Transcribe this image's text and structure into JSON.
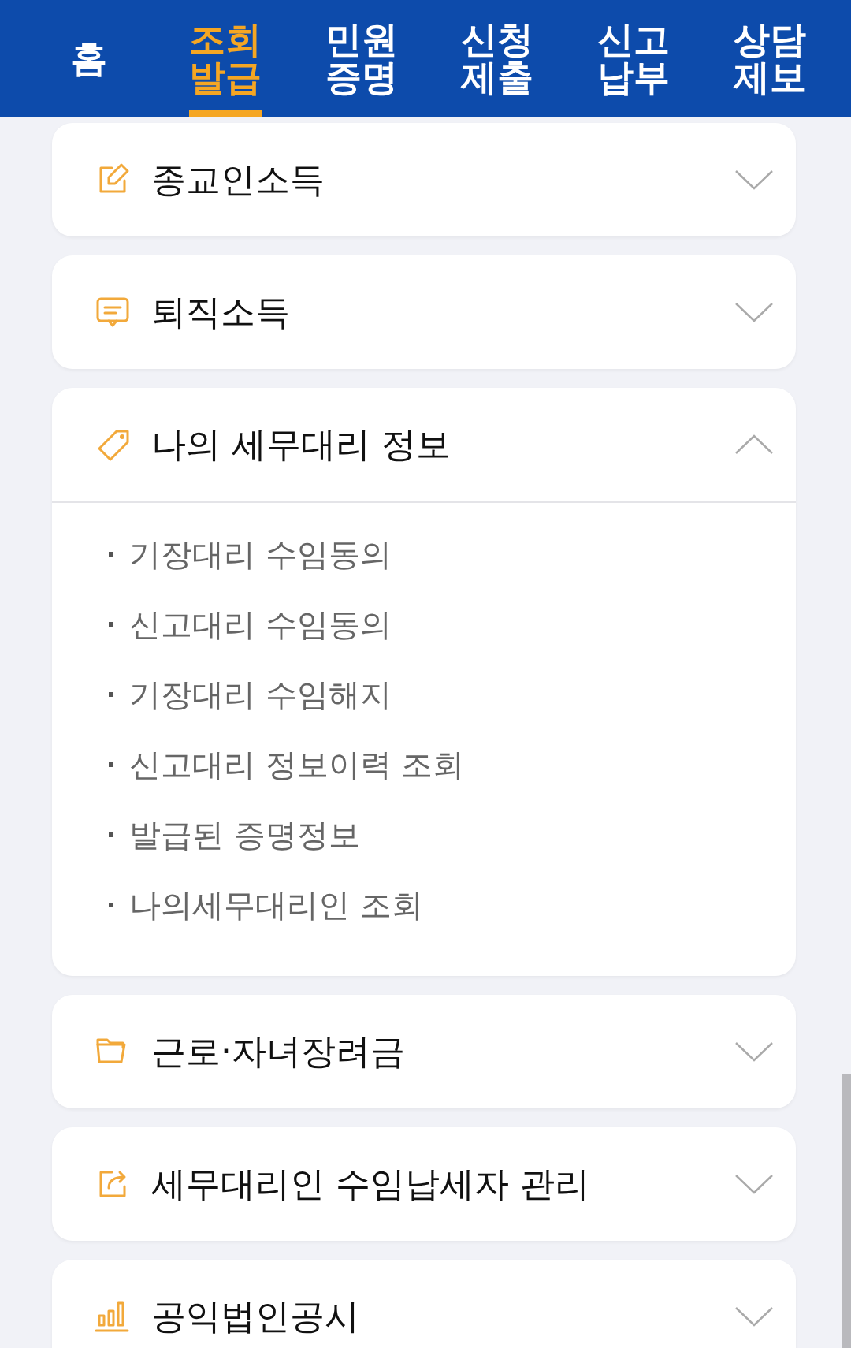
{
  "tabs": [
    {
      "label": "홈",
      "selected": false
    },
    {
      "label": "조회 발급",
      "selected": true
    },
    {
      "label": "민원 증명",
      "selected": false
    },
    {
      "label": "신청 제출",
      "selected": false
    },
    {
      "label": "신고 납부",
      "selected": false
    },
    {
      "label": "상담 제보",
      "selected": false
    }
  ],
  "sections": [
    {
      "kind": "pencil",
      "title": "종교인소득",
      "expanded": false
    },
    {
      "kind": "chat",
      "title": "퇴직소득",
      "expanded": false
    },
    {
      "kind": "tag",
      "title": "나의 세무대리 정보",
      "expanded": true,
      "items": [
        "기장대리 수임동의",
        "신고대리 수임동의",
        "기장대리 수임해지",
        "신고대리 정보이력 조회",
        "발급된 증명정보",
        "나의세무대리인 조회"
      ]
    },
    {
      "kind": "folder",
      "title": "근로·자녀장려금",
      "expanded": false
    },
    {
      "kind": "share",
      "title": "세무대리인 수임납세자 관리",
      "expanded": false
    },
    {
      "kind": "chart",
      "title": "공익법인공시",
      "expanded": false
    }
  ]
}
